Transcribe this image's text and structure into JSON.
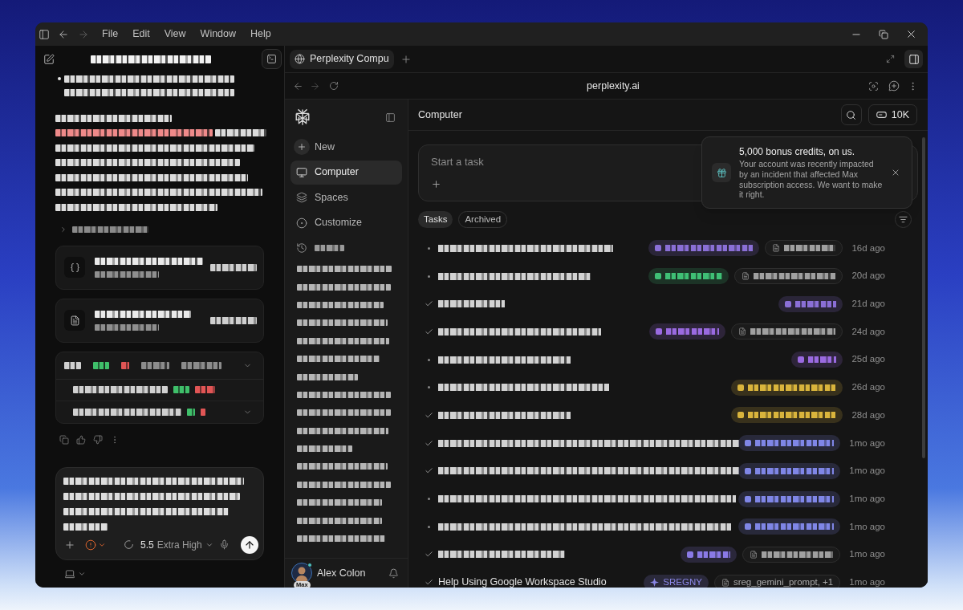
{
  "title_bar": {
    "menu": [
      "File",
      "Edit",
      "View",
      "Window",
      "Help"
    ]
  },
  "chat": {
    "title": {
      "kind": "pixelated"
    },
    "bullet_lines": [
      {
        "kind": "pixelated"
      },
      {
        "kind": "pixelated"
      }
    ],
    "paragraph_lines": [
      [
        {
          "kind": "pixelated",
          "color": "#dcdcdc"
        }
      ],
      [
        {
          "kind": "pixelated",
          "color": "#ef8a8a"
        },
        {
          "kind": "pixelated",
          "color": "#dcdcdc"
        }
      ],
      [
        {
          "kind": "pixelated",
          "color": "#dcdcdc"
        }
      ],
      [
        {
          "kind": "pixelated",
          "color": "#dcdcdc"
        }
      ],
      [
        {
          "kind": "pixelated",
          "color": "#dcdcdc"
        }
      ],
      [
        {
          "kind": "pixelated",
          "color": "#dcdcdc"
        }
      ],
      [
        {
          "kind": "pixelated",
          "color": "#dcdcdc"
        }
      ]
    ],
    "collapsed_row": {
      "kind": "pixelated"
    },
    "cards": [
      {
        "kind": "code",
        "title": {
          "kind": "pixelated"
        },
        "subtitle": {
          "kind": "pixelated"
        },
        "action": {
          "kind": "pixelated"
        }
      },
      {
        "kind": "document",
        "title": {
          "kind": "pixelated"
        },
        "subtitle": {
          "kind": "pixelated"
        },
        "action": {
          "kind": "pixelated"
        }
      }
    ],
    "table_card": {
      "header": [
        {
          "kind": "pixelated",
          "color": "#d0d0d0"
        },
        {
          "kind": "pixelated",
          "color": "#3fbf6a"
        },
        {
          "kind": "pixelated",
          "color": "#e05555"
        },
        {
          "kind": "pixelated",
          "color": "#8c8c8c"
        },
        {
          "kind": "pixelated",
          "color": "#8c8c8c"
        }
      ],
      "rows": [
        [
          {
            "kind": "pixelated",
            "color": "#d0d0d0"
          },
          {
            "kind": "pixelated",
            "color": "#3fbf6a"
          },
          {
            "kind": "pixelated",
            "color": "#e05555"
          }
        ],
        [
          {
            "kind": "pixelated",
            "color": "#d0d0d0"
          },
          {
            "kind": "pixelated",
            "color": "#3fbf6a"
          },
          {
            "kind": "pixelated",
            "color": "#e05555"
          }
        ]
      ]
    },
    "composer": {
      "lines": [
        {
          "kind": "pixelated"
        },
        {
          "kind": "pixelated"
        },
        {
          "kind": "pixelated"
        },
        {
          "kind": "pixelated"
        }
      ],
      "model": "5.5",
      "effort": "Extra High"
    }
  },
  "browser": {
    "tab_title": "Perplexity Compu",
    "url": "perplexity.ai"
  },
  "sidebar": {
    "nav": [
      {
        "kind": "new",
        "label": "New",
        "selected": false
      },
      {
        "kind": "computer",
        "label": "Computer",
        "selected": true
      },
      {
        "kind": "spaces",
        "label": "Spaces",
        "selected": false
      },
      {
        "kind": "customize",
        "label": "Customize",
        "selected": false
      }
    ],
    "history_heading": {
      "kind": "pixelated"
    },
    "threads": [
      {
        "kind": "pixelated"
      },
      {
        "kind": "pixelated"
      },
      {
        "kind": "pixelated"
      },
      {
        "kind": "pixelated"
      },
      {
        "kind": "pixelated"
      },
      {
        "kind": "pixelated"
      },
      {
        "kind": "pixelated"
      },
      {
        "kind": "pixelated"
      },
      {
        "kind": "pixelated"
      },
      {
        "kind": "pixelated"
      },
      {
        "kind": "pixelated"
      },
      {
        "kind": "pixelated"
      },
      {
        "kind": "pixelated"
      },
      {
        "kind": "pixelated"
      },
      {
        "kind": "pixelated"
      },
      {
        "kind": "pixelated"
      }
    ],
    "user": {
      "name": "Alex Colon",
      "badge": "Max"
    }
  },
  "main": {
    "title": "Computer",
    "credits": "10K",
    "task_input": {
      "placeholder": "Start a task"
    },
    "filters": [
      {
        "label": "Tasks",
        "selected": true
      },
      {
        "label": "Archived",
        "selected": false
      }
    ],
    "tasks": [
      {
        "done": false,
        "pixelated": true,
        "tags": [
          {
            "kind": "space",
            "pixelated": true,
            "color": "#8a6fd6"
          },
          {
            "kind": "file",
            "pixelated": true
          }
        ],
        "time": "16d ago"
      },
      {
        "done": false,
        "pixelated": true,
        "tags": [
          {
            "kind": "space",
            "pixelated": true,
            "color": "#3fbf75"
          },
          {
            "kind": "file",
            "pixelated": true
          }
        ],
        "time": "20d ago"
      },
      {
        "done": true,
        "pixelated": true,
        "tags": [
          {
            "kind": "space",
            "pixelated": true,
            "color": "#8a6fd6"
          }
        ],
        "time": "21d ago"
      },
      {
        "done": true,
        "pixelated": true,
        "tags": [
          {
            "kind": "space",
            "pixelated": true,
            "color": "#9a6ae0"
          },
          {
            "kind": "file",
            "pixelated": true
          }
        ],
        "time": "24d ago"
      },
      {
        "done": false,
        "pixelated": true,
        "tags": [
          {
            "kind": "space",
            "pixelated": true,
            "color": "#9a6ae0"
          }
        ],
        "time": "25d ago"
      },
      {
        "done": false,
        "pixelated": true,
        "tags": [
          {
            "kind": "space",
            "pixelated": true,
            "color": "#d9b43c"
          }
        ],
        "time": "26d ago"
      },
      {
        "done": true,
        "pixelated": true,
        "tags": [
          {
            "kind": "space",
            "pixelated": true,
            "color": "#d9b43c"
          }
        ],
        "time": "28d ago"
      },
      {
        "done": true,
        "pixelated": true,
        "tags": [
          {
            "kind": "space",
            "pixelated": true,
            "color": "#7f86e6"
          }
        ],
        "time": "1mo ago"
      },
      {
        "done": true,
        "pixelated": true,
        "tags": [
          {
            "kind": "space",
            "pixelated": true,
            "color": "#7f86e6"
          }
        ],
        "time": "1mo ago"
      },
      {
        "done": false,
        "pixelated": true,
        "tags": [
          {
            "kind": "space",
            "pixelated": true,
            "color": "#7f86e6"
          }
        ],
        "time": "1mo ago"
      },
      {
        "done": false,
        "pixelated": true,
        "tags": [
          {
            "kind": "space",
            "pixelated": true,
            "color": "#7f86e6"
          }
        ],
        "time": "1mo ago"
      },
      {
        "done": true,
        "pixelated": true,
        "tags": [
          {
            "kind": "space",
            "pixelated": true,
            "color": "#8a7ae6"
          },
          {
            "kind": "file",
            "pixelated": true
          }
        ],
        "time": "1mo ago"
      },
      {
        "done": true,
        "pixelated": false,
        "title": "Help Using Google Workspace Studio",
        "tags": [
          {
            "kind": "space",
            "pixelated": false,
            "label": "SREGNY",
            "color": "#8a86e6"
          },
          {
            "kind": "file",
            "pixelated": false,
            "label": "sreg_gemini_prompt, +1"
          }
        ],
        "time": "1mo ago"
      }
    ]
  },
  "notification": {
    "title": "5,000 bonus credits, on us.",
    "body": "Your account was recently impacted by an incident that affected Max subscription access. We want to make it right."
  }
}
